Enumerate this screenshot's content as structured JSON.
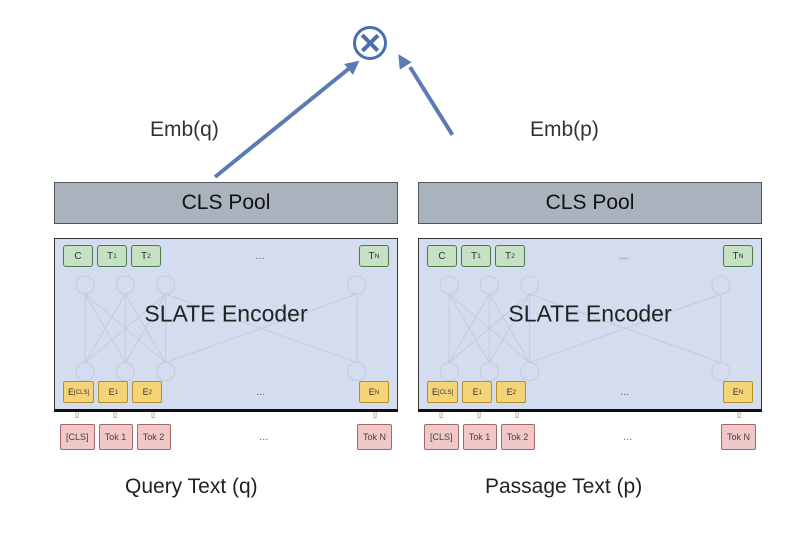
{
  "top": {
    "emb_q": "Emb(q)",
    "emb_p": "Emb(p)"
  },
  "left": {
    "cls_pool": "CLS Pool",
    "encoder": "SLATE Encoder",
    "outputs": {
      "c": "C",
      "t1": "T",
      "t1s": "1",
      "t2": "T",
      "t2s": "2",
      "tn": "T",
      "tns": "N",
      "dots": "..."
    },
    "embs": {
      "e0": "E",
      "e0s": "[CLS]",
      "e1": "E",
      "e1s": "1",
      "e2": "E",
      "e2s": "2",
      "en": "E",
      "ens": "N",
      "dots": "..."
    },
    "inputs": {
      "cls": "[CLS]",
      "t1": "Tok 1",
      "t2": "Tok 2",
      "tn": "Tok N",
      "dots": "..."
    },
    "caption": "Query Text (q)"
  },
  "right": {
    "cls_pool": "CLS Pool",
    "encoder": "SLATE Encoder",
    "outputs": {
      "c": "C",
      "t1": "T",
      "t1s": "1",
      "t2": "T",
      "t2s": "2",
      "tn": "T",
      "tns": "N",
      "dots": "..."
    },
    "embs": {
      "e0": "E",
      "e0s": "[CLS]",
      "e1": "E",
      "e1s": "1",
      "e2": "E",
      "e2s": "2",
      "en": "E",
      "ens": "N",
      "dots": "..."
    },
    "inputs": {
      "cls": "[CLS]",
      "t1": "Tok 1",
      "t2": "Tok 2",
      "tn": "Tok N",
      "dots": "..."
    },
    "caption": "Passage Text (p)"
  }
}
